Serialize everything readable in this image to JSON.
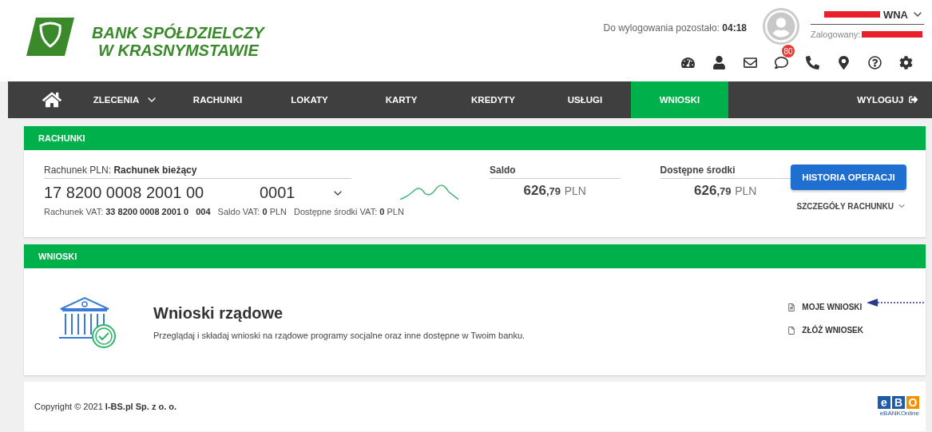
{
  "header": {
    "bank_name_lines": [
      "BANK SPÓŁDZIELCZY",
      "W KRASNYMSTAWIE"
    ],
    "logout_timer": {
      "label": "Do wylogowania pozostało:",
      "value": "04:18"
    },
    "user": {
      "name_visible": "WNA",
      "logged_in_label": "Zalogowany:"
    },
    "messages_badge": "80"
  },
  "nav": {
    "items": [
      {
        "kind": "home",
        "selected": false
      },
      {
        "kind": "dropdown",
        "label": "ZLECENIA",
        "selected": false
      },
      {
        "kind": "link",
        "label": "RACHUNKI",
        "selected": false
      },
      {
        "kind": "link",
        "label": "LOKATY",
        "selected": false
      },
      {
        "kind": "link",
        "label": "KARTY",
        "selected": false
      },
      {
        "kind": "link",
        "label": "KREDYTY",
        "selected": false
      },
      {
        "kind": "link",
        "label": "USŁUGI",
        "selected": false
      },
      {
        "kind": "link",
        "label": "WNIOSKI",
        "selected": true
      }
    ],
    "logout": "WYLOGUJ"
  },
  "accounts": {
    "title": "RACHUNKI",
    "account_label": "Rachunek PLN:",
    "account_name": "Rachunek bieżący",
    "number_start": "17 8200 0008 2001 00",
    "number_end": "0001",
    "vat_account": "Rachunek VAT: **33 8200 0008 2001 0**",
    "vat_account_end": "004",
    "vat_balance": "Saldo VAT: **0** PLN",
    "vat_available": "Dostępne środki VAT: **0** PLN",
    "balances": [
      {
        "label": "Saldo",
        "integer": "626",
        "fraction": ",79",
        "currency": "PLN"
      },
      {
        "label": "Dostępne środki",
        "integer": "626",
        "fraction": ",79",
        "currency": "PLN"
      }
    ],
    "history_button": "HISTORIA OPERACJI",
    "details_link": "SZCZEGÓŁY RACHUNKU"
  },
  "applications": {
    "title": "WNIOSKI",
    "heading": "Wnioski rządowe",
    "description": "Przeglądaj i składaj wnioski na rządowe programy socjalne oraz inne dostępne w Twoim banku.",
    "links": [
      {
        "kind": "list",
        "label": "MOJE WNIOSKI"
      },
      {
        "kind": "new",
        "label": "ZŁÓŻ WNIOSEK"
      }
    ]
  },
  "footer": {
    "copyright": "Copyright © 2021 **I-BS.pl Sp. z o. o.**",
    "logo_letters": [
      "e",
      "B",
      "O"
    ],
    "logo_caption": "eBANKOnline"
  }
}
